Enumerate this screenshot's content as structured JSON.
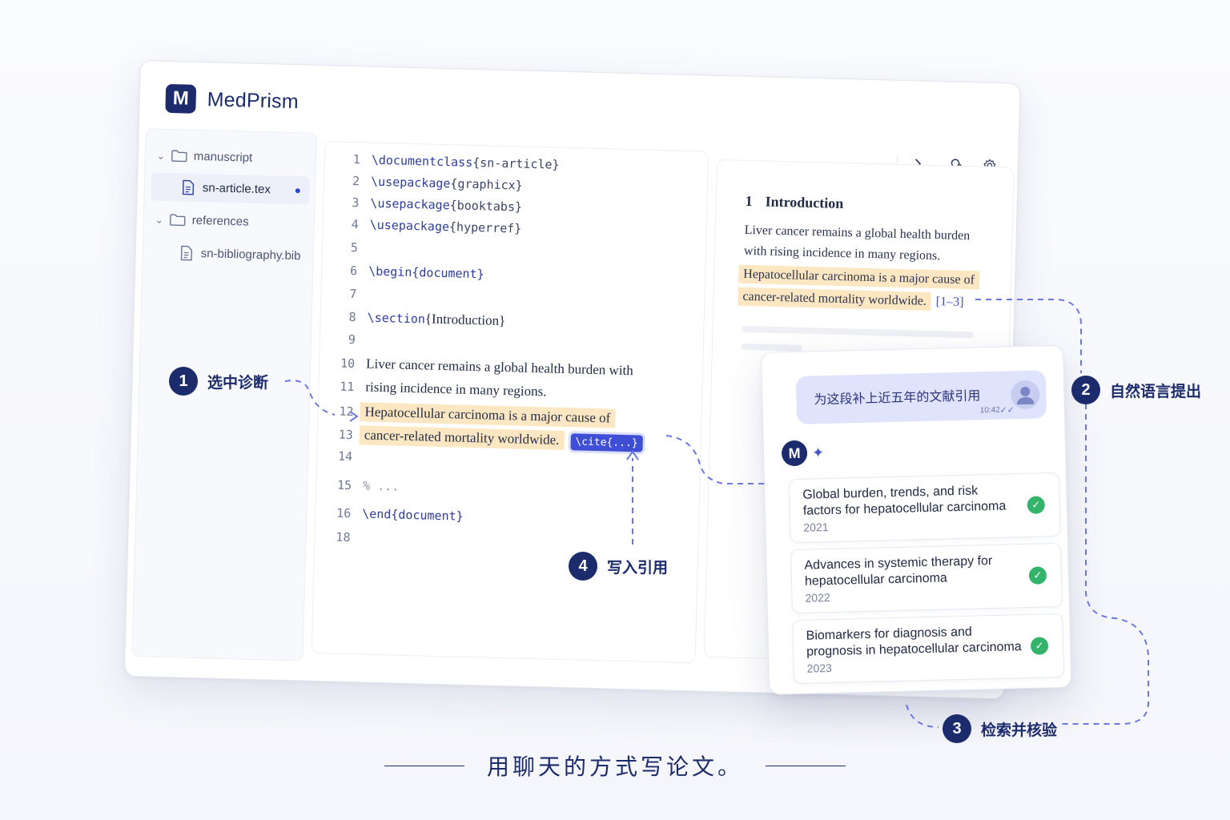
{
  "app": {
    "logo_letter": "M",
    "name": "MedPrism"
  },
  "toolbar": {
    "icons": [
      "terminal-icon",
      "review-icon",
      "settings-icon"
    ]
  },
  "sidebar": {
    "folders": [
      {
        "label": "manuscript",
        "files": [
          {
            "label": "sn-article.tex",
            "active": true
          }
        ]
      },
      {
        "label": "references",
        "files": [
          {
            "label": "sn-bibliography.bib",
            "active": false
          }
        ]
      }
    ]
  },
  "editor": {
    "lines": [
      {
        "n": "1",
        "cmd": "\\documentclass",
        "arg": "{sn-article}"
      },
      {
        "n": "2",
        "cmd": "\\usepackage",
        "arg": "{graphicx}"
      },
      {
        "n": "3",
        "cmd": "\\usepackage",
        "arg": "{booktabs}"
      },
      {
        "n": "4",
        "cmd": "\\usepackage",
        "arg": "{hyperref}"
      },
      {
        "n": "5"
      },
      {
        "n": "6",
        "cmd": "\\begin{document}"
      },
      {
        "n": "7"
      },
      {
        "n": "8",
        "cmd": "\\section",
        "arg": "{Introduction}"
      },
      {
        "n": "9"
      },
      {
        "n": "10",
        "text": "Liver cancer remains a global health burden with"
      },
      {
        "n": "11",
        "text": "rising incidence in many regions."
      },
      {
        "n": "12",
        "text": "Hepatocellular carcinoma is a major cause of"
      },
      {
        "n": "13",
        "text": "cancer-related mortality worldwide.",
        "cite": "\\cite{...}"
      },
      {
        "n": "14"
      },
      {
        "n": "15",
        "comment": "% ..."
      },
      {
        "n": "16",
        "cmd": "\\end{document}"
      },
      {
        "n": "18"
      }
    ]
  },
  "preview": {
    "section_num": "1",
    "section_title": "Introduction",
    "para1_a": "Liver cancer remains a global health burden",
    "para1_b": "with rising incidence in many regions.",
    "hl_a": "Hepatocellular carcinoma is a major cause of",
    "hl_b": "cancer-related mortality worldwide.",
    "cite": "[1–3]"
  },
  "chat": {
    "user_message": "为这段补上近五年的文献引用",
    "time": "10:42",
    "bot_logo": "M",
    "references": [
      {
        "title": "Global burden, trends, and risk factors for hepatocellular carcinoma",
        "year": "2021"
      },
      {
        "title": "Advances in systemic therapy for hepatocellular carcinoma",
        "year": "2022"
      },
      {
        "title": "Biomarkers for diagnosis and prognosis in hepatocellular carcinoma",
        "year": "2023"
      }
    ]
  },
  "steps": [
    {
      "num": "1",
      "label": "选中诊断"
    },
    {
      "num": "2",
      "label": "自然语言提出"
    },
    {
      "num": "3",
      "label": "检索并核验"
    },
    {
      "num": "4",
      "label": "写入引用"
    }
  ],
  "tagline": "用聊天的方式写论文。",
  "colors": {
    "brand": "#1c2b6b",
    "accent": "#3e4fd6",
    "highlight": "#fde7c2",
    "success": "#34b36a"
  }
}
